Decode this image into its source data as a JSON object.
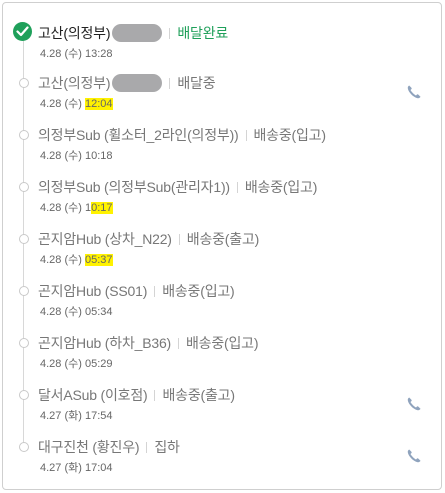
{
  "colors": {
    "done_green": "#1fa05a",
    "highlight": "#fff200",
    "muted_text": "#777777"
  },
  "entries": [
    {
      "location": "고산(의정부)",
      "status": "배달완료",
      "date": "4.28 (수)",
      "time_pre": "",
      "time_hl": "",
      "time_plain": "13:28"
    },
    {
      "location": "고산(의정부)",
      "status": "배달중",
      "date": "4.28 (수)",
      "time_pre": "",
      "time_hl": "12:04",
      "time_plain": ""
    },
    {
      "location": "의정부Sub (휠소터_2라인(의정부))",
      "status": "배송중(입고)",
      "date": "4.28 (수)",
      "time_pre": "",
      "time_hl": "",
      "time_plain": "10:18"
    },
    {
      "location": "의정부Sub (의정부Sub(관리자1))",
      "status": "배송중(입고)",
      "date": "4.28 (수)",
      "time_pre": "1",
      "time_hl": "0:17",
      "time_plain": ""
    },
    {
      "location": "곤지암Hub (상차_N22)",
      "status": "배송중(출고)",
      "date": "4.28 (수)",
      "time_pre": "",
      "time_hl": "05:37",
      "time_plain": ""
    },
    {
      "location": "곤지암Hub (SS01)",
      "status": "배송중(입고)",
      "date": "4.28 (수)",
      "time_pre": "",
      "time_hl": "",
      "time_plain": "05:34"
    },
    {
      "location": "곤지암Hub (하차_B36)",
      "status": "배송중(입고)",
      "date": "4.28 (수)",
      "time_pre": "",
      "time_hl": "",
      "time_plain": "05:29"
    },
    {
      "location": "달서ASub (이호점)",
      "status": "배송중(출고)",
      "date": "4.27 (화)",
      "time_pre": "",
      "time_hl": "",
      "time_plain": "17:54"
    },
    {
      "location": "대구진천 (황진우)",
      "status": "집하",
      "date": "4.27 (화)",
      "time_pre": "",
      "time_hl": "",
      "time_plain": "17:04"
    }
  ],
  "icons": {
    "done": "check-circle-icon",
    "phone": "phone-icon",
    "step": "timeline-dot-icon"
  }
}
